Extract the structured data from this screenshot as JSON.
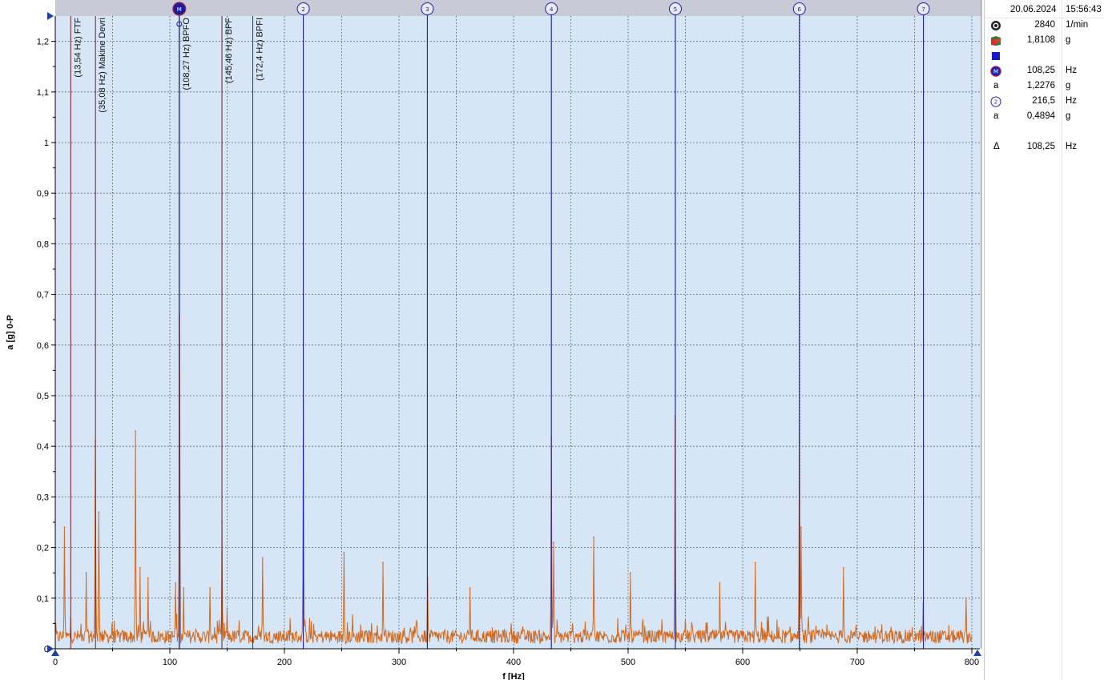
{
  "chart_data": {
    "type": "line",
    "xlabel": "f [Hz]",
    "ylabel": "a [g] 0-P",
    "xlim": [
      0,
      800
    ],
    "ylim": [
      0,
      1.25
    ],
    "grid": true,
    "x_ticks": [
      "0",
      "100",
      "200",
      "300",
      "400",
      "500",
      "600",
      "700",
      "800"
    ],
    "y_ticks": [
      "0",
      "0,1",
      "0,2",
      "0,3",
      "0,4",
      "0,5",
      "0,6",
      "0,7",
      "0,8",
      "0,9",
      "1",
      "1,1",
      "1,2"
    ],
    "series_color": "#d2691e",
    "noise_floor": 0.03,
    "peaks": [
      {
        "x": 8,
        "y": 0.24
      },
      {
        "x": 13.5,
        "y": 0.06
      },
      {
        "x": 27,
        "y": 0.15
      },
      {
        "x": 35,
        "y": 0.41
      },
      {
        "x": 38,
        "y": 0.27
      },
      {
        "x": 70,
        "y": 0.43
      },
      {
        "x": 74,
        "y": 0.16
      },
      {
        "x": 81,
        "y": 0.14
      },
      {
        "x": 105,
        "y": 0.13
      },
      {
        "x": 108.3,
        "y": 0.66
      },
      {
        "x": 112,
        "y": 0.12
      },
      {
        "x": 135,
        "y": 0.12
      },
      {
        "x": 145.5,
        "y": 0.25
      },
      {
        "x": 150,
        "y": 0.08
      },
      {
        "x": 181,
        "y": 0.18
      },
      {
        "x": 216.5,
        "y": 0.49
      },
      {
        "x": 252,
        "y": 0.19
      },
      {
        "x": 286,
        "y": 0.17
      },
      {
        "x": 325,
        "y": 0.14
      },
      {
        "x": 362,
        "y": 0.12
      },
      {
        "x": 433,
        "y": 0.42
      },
      {
        "x": 435,
        "y": 0.21
      },
      {
        "x": 470,
        "y": 0.22
      },
      {
        "x": 502,
        "y": 0.15
      },
      {
        "x": 541,
        "y": 0.46
      },
      {
        "x": 580,
        "y": 0.13
      },
      {
        "x": 611,
        "y": 0.17
      },
      {
        "x": 649.5,
        "y": 0.45
      },
      {
        "x": 651,
        "y": 0.24
      },
      {
        "x": 688,
        "y": 0.16
      },
      {
        "x": 757.5,
        "y": 0.09
      },
      {
        "x": 795,
        "y": 0.1
      }
    ],
    "fault_lines": [
      {
        "x": 13.54,
        "label": "(13,54 Hz) FTF"
      },
      {
        "x": 35.08,
        "label": "(35,08 Hz) Makine Devri"
      },
      {
        "x": 108.27,
        "label": "(108,27 Hz) BPFO"
      },
      {
        "x": 145.46,
        "label": "(145,46 Hz) BPF"
      },
      {
        "x": 172.4,
        "label": "(172,4 Hz) BPFI"
      }
    ],
    "fault_line_color": "#6b1f1f",
    "harmonic_cursors": [
      {
        "x": 108.25,
        "label": "M"
      },
      {
        "x": 216.5,
        "label": "2"
      },
      {
        "x": 324.75,
        "label": "3"
      },
      {
        "x": 433,
        "label": "4"
      },
      {
        "x": 541.25,
        "label": "5"
      },
      {
        "x": 649.5,
        "label": "6"
      },
      {
        "x": 757.75,
        "label": "7"
      }
    ],
    "cursor_color": "#1a1aa6",
    "plot_bg": "#d6e6f6"
  },
  "side_panel": {
    "date": "20.06.2024",
    "time": "15:56:43",
    "rows": [
      {
        "icon": "rpm-icon",
        "value": "2840",
        "unit": "1/min"
      },
      {
        "icon": "overall-level-icon",
        "value": "1,8108",
        "unit": "g"
      },
      {
        "icon": "blue-square-icon",
        "value": "",
        "unit": ""
      },
      {
        "icon": "cursor-m-icon",
        "value": "108,25",
        "unit": "Hz"
      },
      {
        "icon": "a",
        "value": "1,2276",
        "unit": "g"
      },
      {
        "icon": "cursor-2-icon",
        "value": "216,5",
        "unit": "Hz"
      },
      {
        "icon": "a",
        "value": "0,4894",
        "unit": "g"
      },
      {
        "icon": "",
        "value": "",
        "unit": ""
      },
      {
        "icon": "Δ",
        "value": "108,25",
        "unit": "Hz"
      }
    ]
  }
}
